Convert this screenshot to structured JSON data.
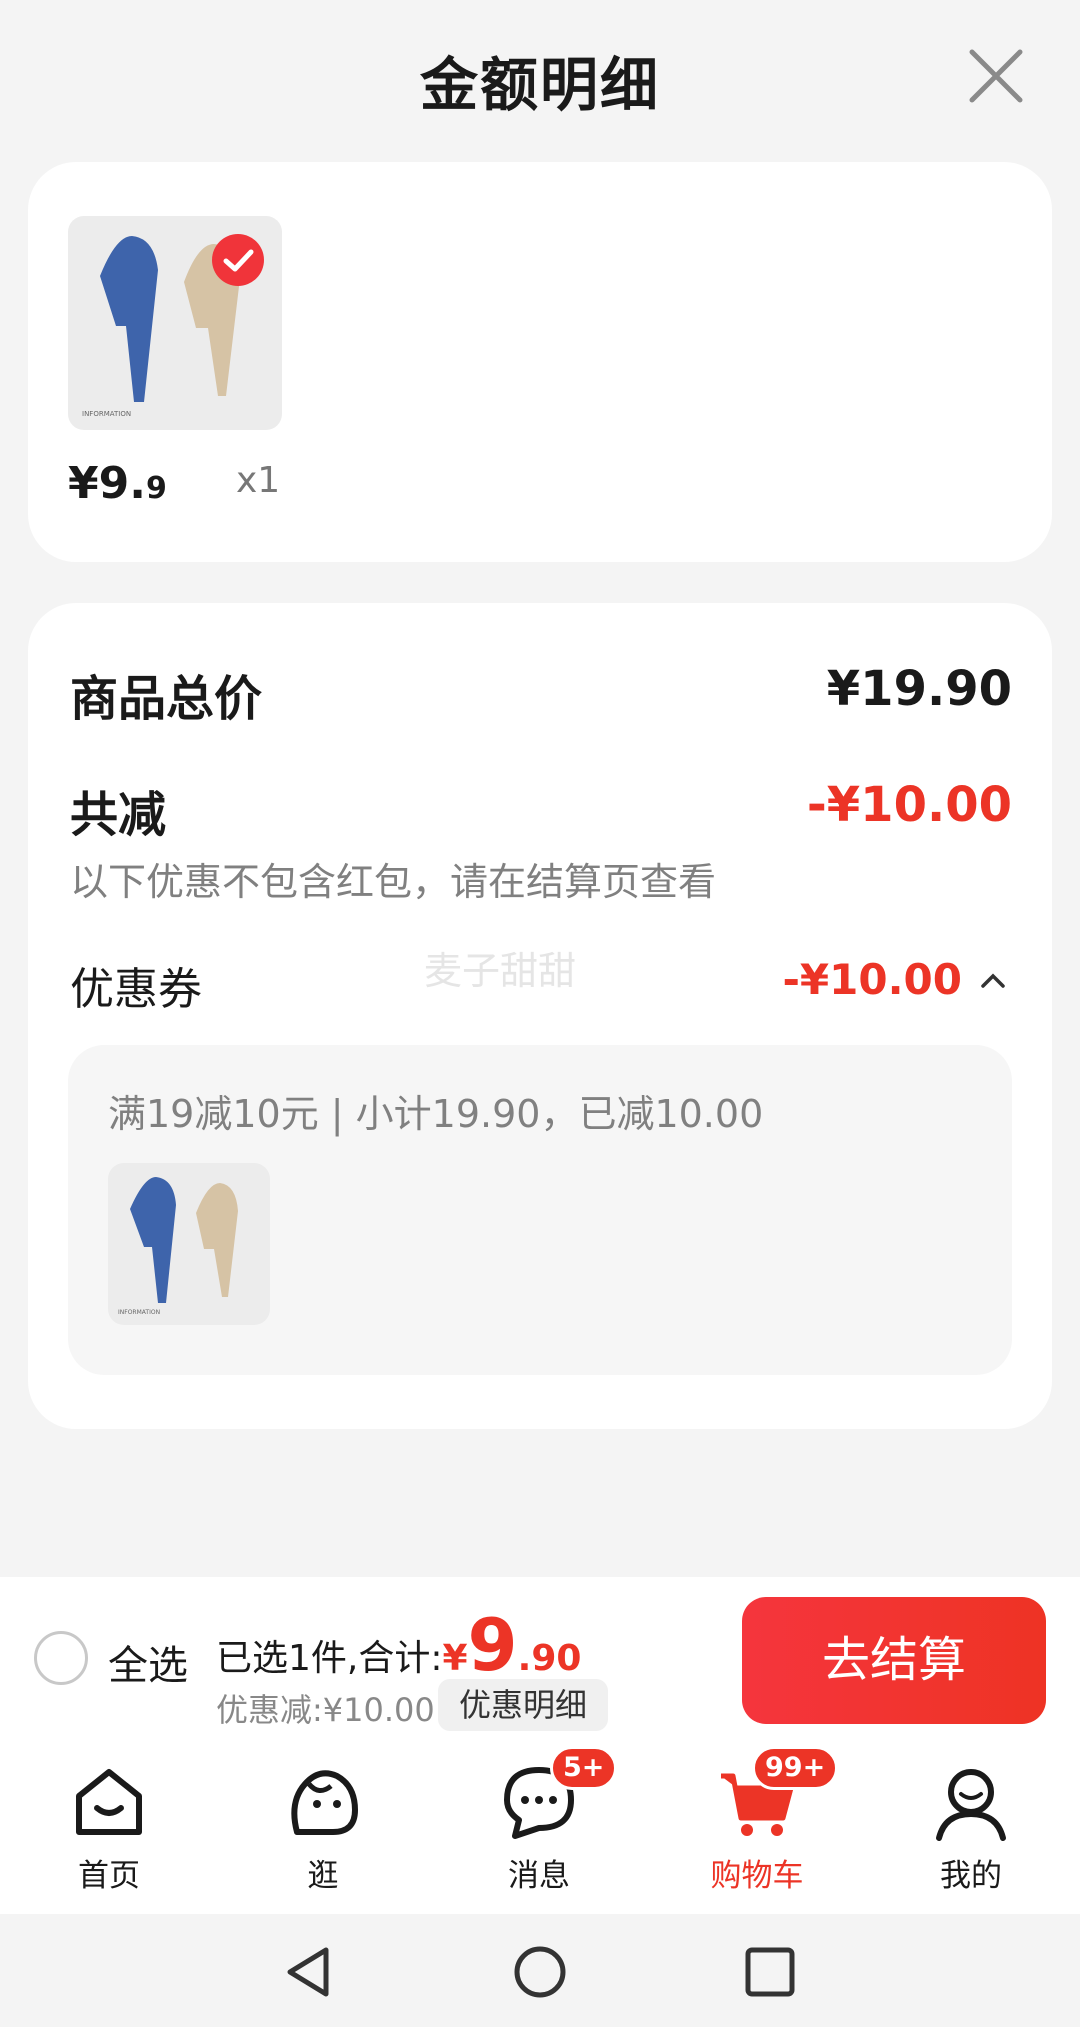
{
  "header": {
    "title": "金额明细"
  },
  "product": {
    "price_main": "¥9.",
    "price_small": "9",
    "qty": "x1",
    "image_text": "INFORMATION"
  },
  "summary": {
    "total_label": "商品总价",
    "total_value": "¥19.90",
    "discount_label": "共减",
    "discount_value": "-¥10.00",
    "note": "以下优惠不包含红包，请在结算页查看",
    "coupon_label": "优惠券",
    "coupon_value": "-¥10.00",
    "watermark": "麦子甜甜"
  },
  "coupon_detail": {
    "desc": "满19减10元 | 小计19.90，已减10.00",
    "image_text": "INFORMATION"
  },
  "bottom_bar": {
    "select_all": "全选",
    "summary_prefix": "已选1件,合计:",
    "currency": "¥",
    "amount_int": "9",
    "amount_dec": ".90",
    "discount_text": "优惠减:¥10.00",
    "discount_detail_button": "优惠明细",
    "checkout_button": "去结算"
  },
  "tabbar": {
    "items": [
      {
        "label": "首页",
        "icon": "home-icon"
      },
      {
        "label": "逛",
        "icon": "browse-icon"
      },
      {
        "label": "消息",
        "icon": "message-icon",
        "badge": "5+"
      },
      {
        "label": "购物车",
        "icon": "cart-icon",
        "badge": "99+",
        "active": true
      },
      {
        "label": "我的",
        "icon": "profile-icon"
      }
    ]
  },
  "colors": {
    "accent": "#ec3426",
    "background": "#f4f4f4"
  }
}
